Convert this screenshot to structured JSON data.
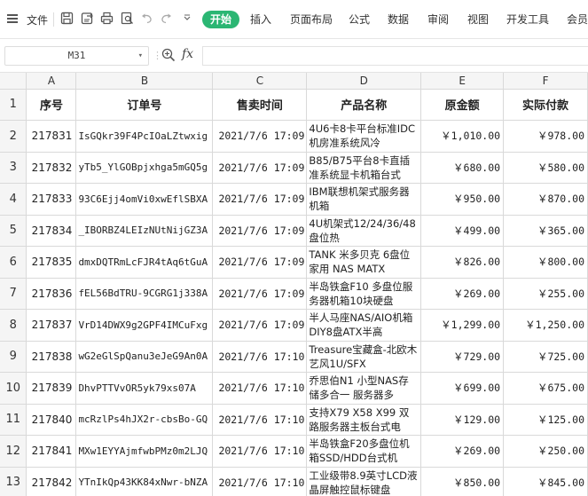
{
  "menu": {
    "file_label": "文件",
    "tabs": [
      {
        "label": "开始",
        "active": true
      },
      {
        "label": "插入",
        "active": false
      },
      {
        "label": "页面布局",
        "active": false
      },
      {
        "label": "公式",
        "active": false
      },
      {
        "label": "数据",
        "active": false
      },
      {
        "label": "审阅",
        "active": false
      },
      {
        "label": "视图",
        "active": false
      },
      {
        "label": "开发工具",
        "active": false
      },
      {
        "label": "会员专",
        "active": false
      }
    ],
    "accent_color": "#2bb673"
  },
  "formula_bar": {
    "cell_ref": "M31",
    "fx_label": "fx",
    "formula": ""
  },
  "sheet": {
    "columns": [
      "A",
      "B",
      "C",
      "D",
      "E",
      "F"
    ],
    "headers": [
      "序号",
      "订单号",
      "售卖时间",
      "产品名称",
      "原金额",
      "实际付款"
    ],
    "rows": [
      {
        "n": "1",
        "cells": [
          "217831",
          "IsGQkr39F4PcIOaLZtwxig",
          "2021/7/6 17:09",
          "4U6卡8卡平台标准IDC机房准系统风冷",
          "￥1,010.00",
          "￥978.00"
        ]
      },
      {
        "n": "2",
        "cells": [
          "217832",
          "yTb5_YlGOBpjxhga5mGQ5g",
          "2021/7/6 17:09",
          "B85/B75平台8卡直插准系统显卡机箱台式",
          "￥680.00",
          "￥580.00"
        ]
      },
      {
        "n": "3",
        "cells": [
          "217833",
          "93C6Ejj4omVi0xwEflSBXA",
          "2021/7/6 17:09",
          "IBM联想机架式服务器机箱",
          "￥950.00",
          "￥870.00"
        ]
      },
      {
        "n": "4",
        "cells": [
          "217834",
          "_IBORBZ4LEIzNUtNijGZ3A",
          "2021/7/6 17:09",
          "4U机架式12/24/36/48盘位热",
          "￥499.00",
          "￥365.00"
        ]
      },
      {
        "n": "5",
        "cells": [
          "217835",
          "dmxDQTRmLcFJR4tAq6tGuA",
          "2021/7/6 17:09",
          "TANK 米多贝克 6盘位 家用 NAS MATX",
          "￥826.00",
          "￥800.00"
        ]
      },
      {
        "n": "6",
        "cells": [
          "217836",
          "fEL56BdTRU-9CGRG1j338A",
          "2021/7/6 17:09",
          "半岛铁盒F10 多盘位服务器机箱10块硬盘",
          "￥269.00",
          "￥255.00"
        ]
      },
      {
        "n": "7",
        "cells": [
          "217837",
          "VrD14DWX9g2GPF4IMCuFxg",
          "2021/7/6 17:09",
          "半人马座NAS/AIO机箱DIY8盘ATX半高",
          "￥1,299.00",
          "￥1,250.00"
        ]
      },
      {
        "n": "8",
        "cells": [
          "217838",
          "wG2eGlSpQanu3eJeG9An0A",
          "2021/7/6 17:10",
          "Treasure宝藏盒-北欧木艺风1U/SFX",
          "￥729.00",
          "￥725.00"
        ]
      },
      {
        "n": "9",
        "cells": [
          "217839",
          "DhvPTTVvOR5yk79xs07A",
          "2021/7/6 17:10",
          "乔思伯N1 小型NAS存储多合一 服务器多",
          "￥699.00",
          "￥675.00"
        ]
      },
      {
        "n": "10",
        "cells": [
          "217840",
          "mcRzlPs4hJX2r-cbsBo-GQ",
          "2021/7/6 17:10",
          "支持X79 X58 X99 双路服务器主板台式电",
          "￥129.00",
          "￥125.00"
        ]
      },
      {
        "n": "11",
        "cells": [
          "217841",
          "MXw1EYYAjmfwbPMz0m2LJQ",
          "2021/7/6 17:10",
          "半岛铁盒F20多盘位机箱SSD/HDD台式机",
          "￥269.00",
          "￥250.00"
        ]
      },
      {
        "n": "12",
        "cells": [
          "217842",
          "YTnIkQp43KK84xNwr-bNZA",
          "2021/7/6 17:10",
          "工业级带8.9英寸LCD液晶屏触控鼠标键盘",
          "￥850.00",
          "￥845.00"
        ]
      }
    ]
  }
}
